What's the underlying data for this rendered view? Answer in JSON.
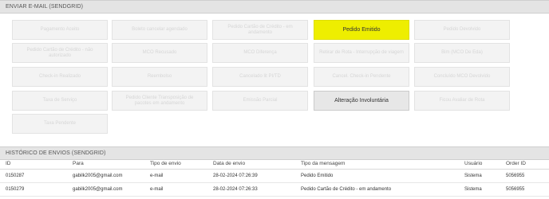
{
  "send_section": {
    "title": "ENVIAR E-MAIL (SENDGRID)",
    "buttons": [
      {
        "label": "Pagamento Aceito",
        "state": "disabled"
      },
      {
        "label": "Boleto cancelar agendado",
        "state": "disabled"
      },
      {
        "label": "Pedido Cartão de Crédito - em andamento",
        "state": "disabled"
      },
      {
        "label": "Pedido Emitido",
        "state": "highlight"
      },
      {
        "label": "Pedido Devolvido",
        "state": "disabled"
      },
      {
        "label": "Pedido Cartão de Crédito - não autorizado",
        "state": "disabled"
      },
      {
        "label": "MCO Recusado",
        "state": "disabled"
      },
      {
        "label": "MCO Diferença",
        "state": "disabled"
      },
      {
        "label": "Retirar de Rota - Interrupção de viagem",
        "state": "disabled"
      },
      {
        "label": "Bim (MCO De Eda)",
        "state": "disabled"
      },
      {
        "label": "Check-in Realizado",
        "state": "disabled"
      },
      {
        "label": "Reembolso",
        "state": "disabled"
      },
      {
        "label": "Cancelado lit PI/TD",
        "state": "disabled"
      },
      {
        "label": "Cancel. Check-in Pendente",
        "state": "disabled"
      },
      {
        "label": "Concluído MCO Devolvido",
        "state": "disabled"
      },
      {
        "label": "Taxa de Serviço",
        "state": "disabled"
      },
      {
        "label": "Pedido Cliente Transposição de pacotes em andamento",
        "state": "disabled"
      },
      {
        "label": "Emissão Parcial",
        "state": "disabled"
      },
      {
        "label": "Alteração Involuntária",
        "state": "active"
      },
      {
        "label": "Ficou Avaliar de Rota",
        "state": "disabled"
      },
      {
        "label": "Taxa Pendente",
        "state": "disabled"
      }
    ]
  },
  "history_section": {
    "title": "HISTÓRICO DE ENVIOS (SENDGRID)",
    "columns": [
      "ID",
      "Para",
      "Tipo de envio",
      "Data de envio",
      "Tipo da mensagem",
      "Usuário",
      "Order ID"
    ],
    "rows": [
      [
        "0150287",
        "gabilk2005@gmail.com",
        "e-mail",
        "28-02-2024 07:26:39",
        "Pedido Emitido",
        "Sistema",
        "5056955"
      ],
      [
        "0150279",
        "gabilk2005@gmail.com",
        "e-mail",
        "28-02-2024 07:26:33",
        "Pedido Cartão de Crédito - em andamento",
        "Sistema",
        "5056955"
      ]
    ]
  },
  "colors": {
    "highlight": "#eeee00",
    "header_bg": "#e4e4e4"
  }
}
